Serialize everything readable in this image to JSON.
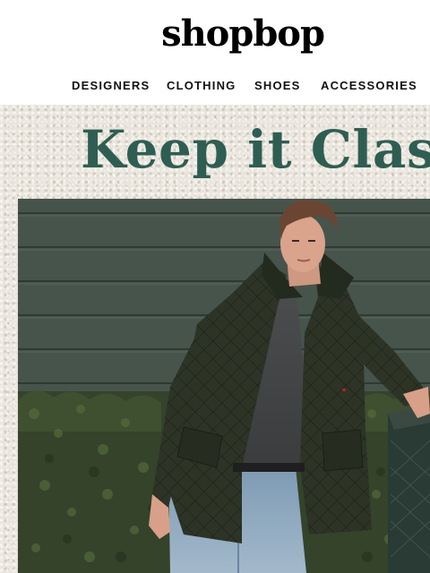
{
  "header": {
    "logo": "shopbop",
    "nav": [
      {
        "label": "DESIGNERS"
      },
      {
        "label": "CLOTHING"
      },
      {
        "label": "SHOES"
      },
      {
        "label": "ACCESSORIES"
      }
    ]
  },
  "hero": {
    "headline": "Keep it Classic"
  },
  "colors": {
    "headline": "#2e5e52",
    "siding": "#46544c",
    "hedge": "#3a4a2c",
    "jacket": "#2c3324"
  }
}
